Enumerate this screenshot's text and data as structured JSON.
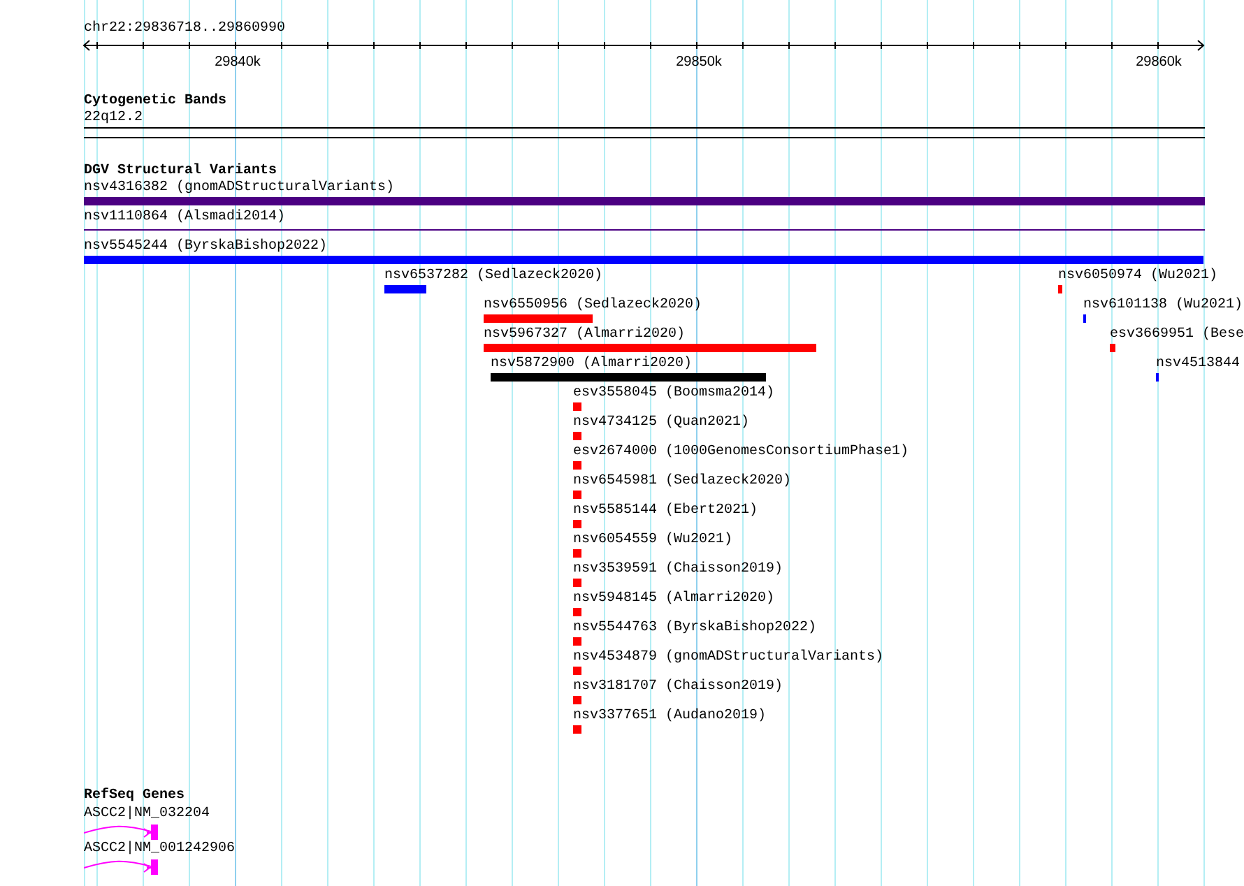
{
  "ruler": {
    "location": "chr22:29836718..29860990",
    "ticks": [
      "29840k",
      "29850k",
      "29860k"
    ]
  },
  "tracks": [
    {
      "kind": "bands",
      "title": "Cytogenetic Bands",
      "features": [
        {
          "label": "22q12.2"
        }
      ]
    },
    {
      "kind": "variants",
      "title": "DGV Structural Variants",
      "features": [
        {
          "kind": "bar",
          "label": "nsv4316382 (gnomADStructuralVariants)",
          "color": "#4b0082"
        },
        {
          "kind": "line",
          "label": "nsv1110864 (Alsmadi2014)",
          "color": "#4b0082"
        },
        {
          "kind": "bar",
          "label": "nsv5545244 (ByrskaBishop2022)",
          "color": "#0000ff"
        },
        {
          "kind": "bar",
          "label": "nsv6537282 (Sedlazeck2020)",
          "color": "#0000ff"
        },
        {
          "kind": "bar",
          "label": "nsv6050974 (Wu2021)",
          "color": "#ff0000"
        },
        {
          "kind": "bar",
          "label": "nsv6550956 (Sedlazeck2020)",
          "color": "#ff0000"
        },
        {
          "kind": "bar",
          "label": "nsv6101138 (Wu2021)",
          "color": "#0000ff"
        },
        {
          "kind": "bar",
          "label": "nsv5967327 (Almarri2020)",
          "color": "#ff0000"
        },
        {
          "kind": "bar",
          "label": "esv3669951 (Bese",
          "color": "#ff0000"
        },
        {
          "kind": "bar",
          "label": "nsv5872900 (Almarri2020)",
          "color": "#000000"
        },
        {
          "kind": "bar",
          "label": "nsv4513844",
          "color": "#0000ff"
        },
        {
          "kind": "bar",
          "label": "esv3558045 (Boomsma2014)",
          "color": "#ff0000"
        },
        {
          "kind": "bar",
          "label": "nsv4734125 (Quan2021)",
          "color": "#ff0000"
        },
        {
          "kind": "bar",
          "label": "esv2674000 (1000GenomesConsortiumPhase1)",
          "color": "#ff0000"
        },
        {
          "kind": "bar",
          "label": "nsv6545981 (Sedlazeck2020)",
          "color": "#ff0000"
        },
        {
          "kind": "bar",
          "label": "nsv5585144 (Ebert2021)",
          "color": "#ff0000"
        },
        {
          "kind": "bar",
          "label": "nsv6054559 (Wu2021)",
          "color": "#ff0000"
        },
        {
          "kind": "bar",
          "label": "nsv3539591 (Chaisson2019)",
          "color": "#ff0000"
        },
        {
          "kind": "bar",
          "label": "nsv5948145 (Almarri2020)",
          "color": "#ff0000"
        },
        {
          "kind": "bar",
          "label": "nsv5544763 (ByrskaBishop2022)",
          "color": "#ff0000"
        },
        {
          "kind": "bar",
          "label": "nsv4534879 (gnomADStructuralVariants)",
          "color": "#ff0000"
        },
        {
          "kind": "bar",
          "label": "nsv3181707 (Chaisson2019)",
          "color": "#ff0000"
        },
        {
          "kind": "bar",
          "label": "nsv3377651 (Audano2019)",
          "color": "#ff0000"
        }
      ]
    },
    {
      "kind": "genes",
      "title": "RefSeq Genes",
      "features": [
        {
          "label": "ASCC2|NM_032204"
        },
        {
          "label": "ASCC2|NM_001242906"
        }
      ]
    }
  ]
}
